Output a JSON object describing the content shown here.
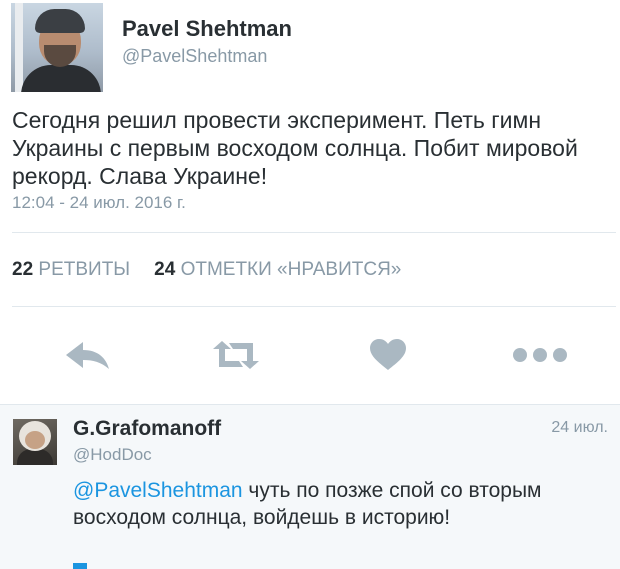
{
  "tweet": {
    "author_name": "Pavel Shehtman",
    "author_handle": "@PavelShehtman",
    "text": "Сегодня решил провести эксперимент. Петь гимн Украины с первым восходом солнца. Побит мировой рекорд. Слава Украине!",
    "timestamp": "12:04 - 24 июл. 2016 г.",
    "retweets_count": "22",
    "retweets_label": "РЕТВИТЫ",
    "likes_count": "24",
    "likes_label": "ОТМЕТКИ «НРАВИТСЯ»"
  },
  "actions": {
    "icons": [
      "reply-icon",
      "retweet-icon",
      "heart-icon",
      "more-icon"
    ],
    "color": "#aab8c2"
  },
  "reply": {
    "author_name": "G.Grafomanoff",
    "author_handle": "@HodDoc",
    "date": "24 июл.",
    "mention": "@PavelShehtman",
    "text": " чуть по позже спой со вторым восходом солнца, войдешь в историю!"
  },
  "colors": {
    "text": "#292f33",
    "muted": "#8899a6",
    "link": "#1b95e0",
    "divider": "#e1e8ed",
    "reply_bg": "#f5f8fa"
  }
}
